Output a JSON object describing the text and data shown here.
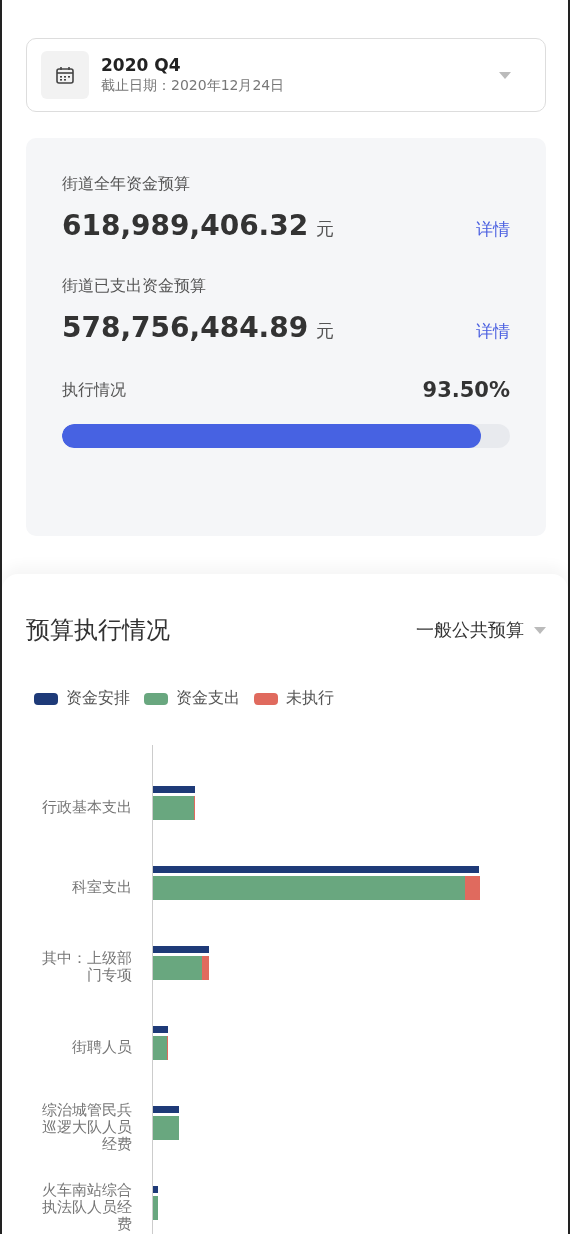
{
  "period_selector": {
    "title": "2020 Q4",
    "subtitle": "截止日期：2020年12月24日"
  },
  "summary": {
    "items": [
      {
        "label": "街道全年资金预算",
        "amount": "618,989,406.32",
        "unit": "元",
        "link": "详情"
      },
      {
        "label": "街道已支出资金预算",
        "amount": "578,756,484.89",
        "unit": "元",
        "link": "详情"
      }
    ],
    "progress": {
      "label": "执行情况",
      "reading": "93.50%",
      "level": 0.935
    }
  },
  "budget_section": {
    "title": "预算执行情况",
    "dropdown": "一般公共预算",
    "legend": [
      {
        "label": "资金安排",
        "color": "#1e3a78"
      },
      {
        "label": "资金支出",
        "color": "#69a77f"
      },
      {
        "label": "未执行",
        "color": "#e06a5e"
      }
    ],
    "categories": [
      "行政基本支出",
      "科室支出",
      "其中：上级部门专项",
      "街聘人员",
      "综治城管民兵巡逻大队人员经费",
      "火车南站综合执法队人员经费"
    ]
  }
}
